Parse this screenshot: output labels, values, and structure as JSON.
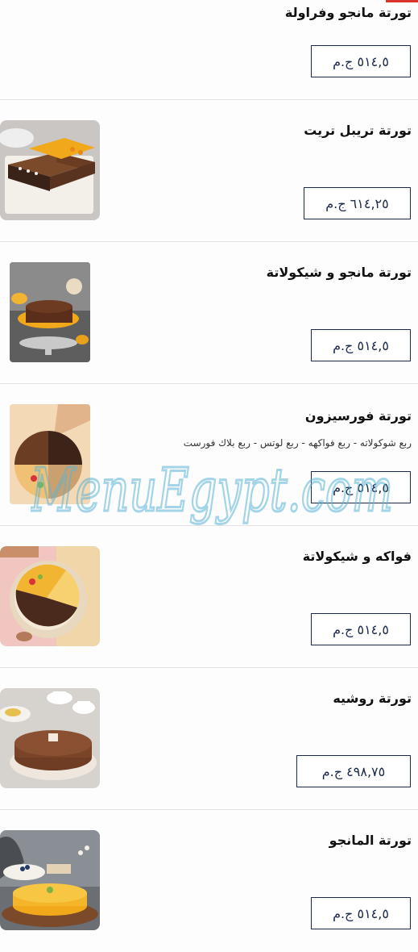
{
  "items": [
    {
      "title": "تورتة مانجو وفراولة",
      "price": "٥١٤,٥ ج.م",
      "description": "",
      "image": "none"
    },
    {
      "title": "تورتة تريبل تريت",
      "price": "٦١٤,٢٥ ج.م",
      "description": "",
      "image": "triple-treat-cake-photo"
    },
    {
      "title": "تورتة مانجو و شيكولاتة",
      "price": "٥١٤,٥ ج.م",
      "description": "",
      "image": "mango-chocolate-cake-photo"
    },
    {
      "title": "تورتة فورسيزون",
      "price": "٥١٤,٥ ج.م",
      "description": "ربع شوكولاته - ربع فواكهه - ربع لوتس - ربع بلاك فورست",
      "image": "four-season-cake-photo"
    },
    {
      "title": "فواكه و شيكولاتة",
      "price": "٥١٤,٥ ج.م",
      "description": "",
      "image": "fruit-chocolate-cake-photo"
    },
    {
      "title": "تورتة روشيه",
      "price": "٤٩٨,٧٥ ج.م",
      "description": "",
      "image": "rocher-cake-photo"
    },
    {
      "title": "تورتة المانجو",
      "price": "٥١٤,٥ ج.م",
      "description": "",
      "image": "mango-cake-photo"
    }
  ],
  "watermark": "MenuEgypt.com",
  "colors": {
    "price_border": "#1c2a4a",
    "divider": "#e2e2e2",
    "accent": "#d9342b",
    "watermark": "#5ab4d6"
  }
}
